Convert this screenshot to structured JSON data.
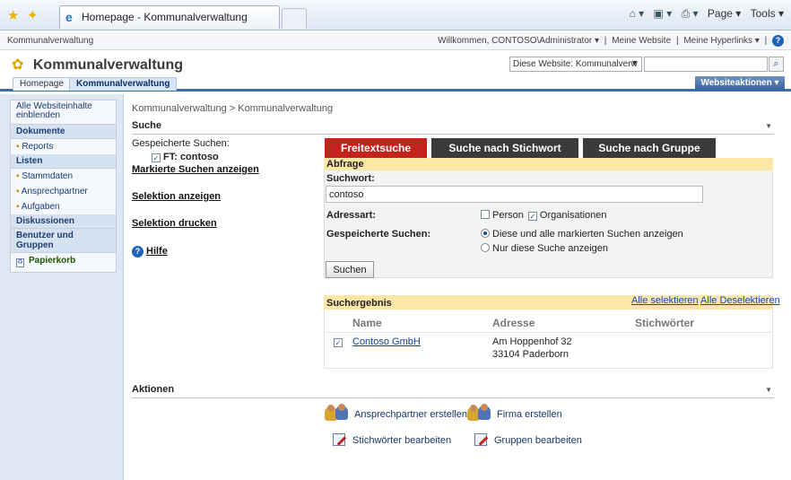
{
  "browser": {
    "tab_title": "Homepage - Kommunalverwaltung",
    "commands": {
      "page": "Page ▾",
      "tools": "Tools ▾"
    }
  },
  "topbar": {
    "site": "Kommunalverwaltung",
    "welcome": "Willkommen, CONTOSO\\Administrator ▾",
    "separator": "|",
    "my_site": "Meine Website",
    "my_links": "Meine Hyperlinks ▾"
  },
  "header": {
    "title": "Kommunalverwaltung",
    "search_scope": "Diese Website: Kommunalverw",
    "search_value": ""
  },
  "tabs": [
    {
      "label": "Homepage",
      "selected": false
    },
    {
      "label": "Kommunalverwaltung",
      "selected": true
    }
  ],
  "site_actions": "Websiteaktionen ▾",
  "quicklaunch": {
    "all_content": "Alle Websiteinhalte einblenden",
    "documents_header": "Dokumente",
    "documents": [
      "Reports"
    ],
    "lists_header": "Listen",
    "lists": [
      "Stammdaten",
      "Ansprechpartner",
      "Aufgaben"
    ],
    "discussions_header": "Diskussionen",
    "people_header": "Benutzer und Gruppen",
    "recycle_bin": "Papierkorb"
  },
  "main": {
    "breadcrumb": "Kommunalverwaltung > Kommunalverwaltung",
    "search_section": "Suche",
    "saved_searches_label": "Gespeicherte Suchen:",
    "saved_search_item": "FT: contoso",
    "link_marked": "Markierte Suchen anzeigen",
    "link_selection_show": "Selektion anzeigen",
    "link_selection_print": "Selektion drucken",
    "link_help": "Hilfe",
    "search_tabs": [
      "Freitextsuche",
      "Suche nach Stichwort",
      "Suche nach Gruppe"
    ],
    "query": {
      "header": "Abfrage",
      "keyword_label": "Suchwort:",
      "keyword_value": "contoso",
      "address_type_label": "Adressart:",
      "option_person": "Person",
      "option_org": "Organisationen",
      "saved_label": "Gespeicherte Suchen:",
      "radio_all": "Diese und alle markierten Suchen anzeigen",
      "radio_only": "Nur diese Suche anzeigen",
      "button": "Suchen"
    },
    "results": {
      "header": "Suchergebnis",
      "select_all": "Alle selektieren",
      "deselect_all": "Alle Deselektieren",
      "columns": [
        "Name",
        "Adresse",
        "Stichwörter"
      ],
      "rows": [
        {
          "name": "Contoso GmbH",
          "address_line1": "Am Hoppenhof 32",
          "address_line2": "33104 Paderborn",
          "keywords": ""
        }
      ]
    },
    "actions_section": "Aktionen",
    "actions": {
      "create_contact": "Ansprechpartner erstellen",
      "create_company": "Firma erstellen",
      "edit_keywords": "Stichwörter bearbeiten",
      "edit_groups": "Gruppen bearbeiten"
    }
  },
  "colors": {
    "tab_active": "#c4221d",
    "tab_inactive": "#3a3a3a",
    "panel_header": "#fbe7a6",
    "site_actions": "#365f98",
    "left_nav_bg": "#dfe7f3"
  }
}
